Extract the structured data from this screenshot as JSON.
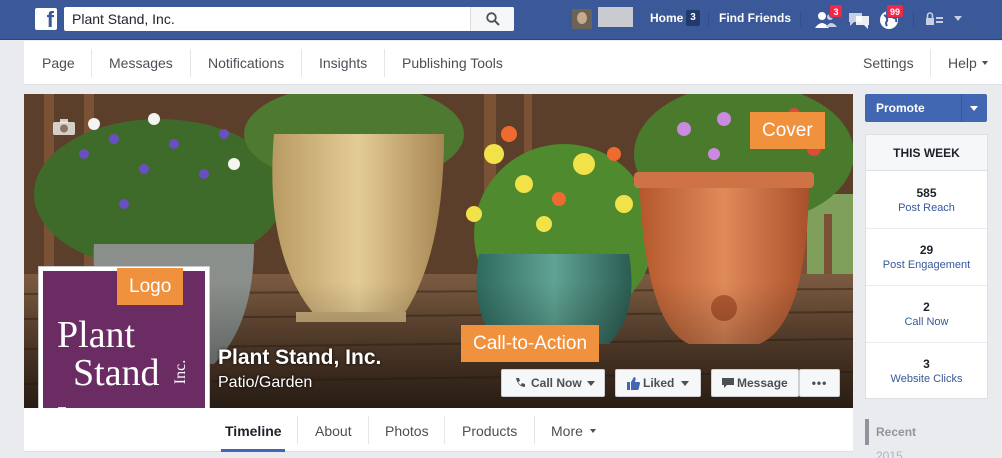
{
  "topbar": {
    "search_value": "Plant Stand, Inc.",
    "home_label": "Home",
    "home_count": "3",
    "find_friends_label": "Find Friends",
    "friend_requests_badge": "3",
    "notifications_badge": "99",
    "brand_color": "#3b5998"
  },
  "page_nav": {
    "left": [
      "Page",
      "Messages",
      "Notifications",
      "Insights",
      "Publishing Tools"
    ],
    "settings": "Settings",
    "help": "Help"
  },
  "cover": {
    "page_name": "Plant Stand, Inc.",
    "category": "Patio/Garden",
    "annotations": {
      "cover": "Cover",
      "logo": "Logo",
      "cta": "Call-to-Action"
    },
    "annotation_color": "#f0913e"
  },
  "logo": {
    "line1": "Plant",
    "line2": "Stand",
    "suffix": "Inc.",
    "bg_color": "#6a2c62"
  },
  "actions": {
    "call_now": "Call Now",
    "liked": "Liked",
    "message": "Message",
    "more": "•••"
  },
  "tabs": [
    "Timeline",
    "About",
    "Photos",
    "Products",
    "More"
  ],
  "sidebar": {
    "promote": "Promote",
    "this_week": "THIS WEEK",
    "stats": [
      {
        "value": "585",
        "label": "Post Reach"
      },
      {
        "value": "29",
        "label": "Post Engagement"
      },
      {
        "value": "2",
        "label": "Call Now"
      },
      {
        "value": "3",
        "label": "Website Clicks"
      }
    ],
    "recent": "Recent",
    "year": "2015"
  }
}
